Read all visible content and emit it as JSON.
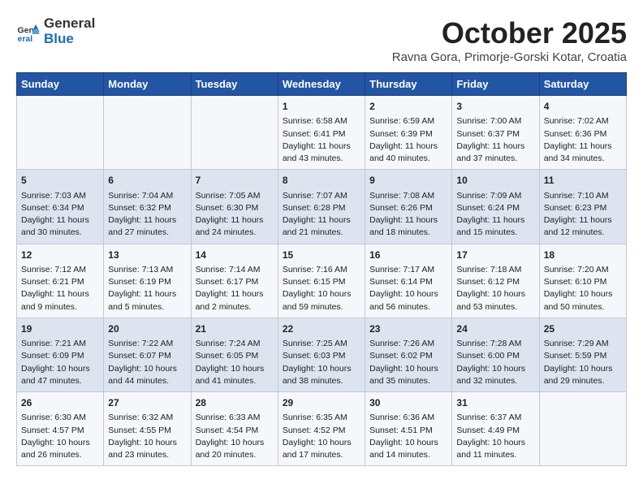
{
  "header": {
    "logo_line1": "General",
    "logo_line2": "Blue",
    "month": "October 2025",
    "location": "Ravna Gora, Primorje-Gorski Kotar, Croatia"
  },
  "days_of_week": [
    "Sunday",
    "Monday",
    "Tuesday",
    "Wednesday",
    "Thursday",
    "Friday",
    "Saturday"
  ],
  "weeks": [
    [
      {
        "day": "",
        "info": ""
      },
      {
        "day": "",
        "info": ""
      },
      {
        "day": "",
        "info": ""
      },
      {
        "day": "1",
        "info": "Sunrise: 6:58 AM\nSunset: 6:41 PM\nDaylight: 11 hours\nand 43 minutes."
      },
      {
        "day": "2",
        "info": "Sunrise: 6:59 AM\nSunset: 6:39 PM\nDaylight: 11 hours\nand 40 minutes."
      },
      {
        "day": "3",
        "info": "Sunrise: 7:00 AM\nSunset: 6:37 PM\nDaylight: 11 hours\nand 37 minutes."
      },
      {
        "day": "4",
        "info": "Sunrise: 7:02 AM\nSunset: 6:36 PM\nDaylight: 11 hours\nand 34 minutes."
      }
    ],
    [
      {
        "day": "5",
        "info": "Sunrise: 7:03 AM\nSunset: 6:34 PM\nDaylight: 11 hours\nand 30 minutes."
      },
      {
        "day": "6",
        "info": "Sunrise: 7:04 AM\nSunset: 6:32 PM\nDaylight: 11 hours\nand 27 minutes."
      },
      {
        "day": "7",
        "info": "Sunrise: 7:05 AM\nSunset: 6:30 PM\nDaylight: 11 hours\nand 24 minutes."
      },
      {
        "day": "8",
        "info": "Sunrise: 7:07 AM\nSunset: 6:28 PM\nDaylight: 11 hours\nand 21 minutes."
      },
      {
        "day": "9",
        "info": "Sunrise: 7:08 AM\nSunset: 6:26 PM\nDaylight: 11 hours\nand 18 minutes."
      },
      {
        "day": "10",
        "info": "Sunrise: 7:09 AM\nSunset: 6:24 PM\nDaylight: 11 hours\nand 15 minutes."
      },
      {
        "day": "11",
        "info": "Sunrise: 7:10 AM\nSunset: 6:23 PM\nDaylight: 11 hours\nand 12 minutes."
      }
    ],
    [
      {
        "day": "12",
        "info": "Sunrise: 7:12 AM\nSunset: 6:21 PM\nDaylight: 11 hours\nand 9 minutes."
      },
      {
        "day": "13",
        "info": "Sunrise: 7:13 AM\nSunset: 6:19 PM\nDaylight: 11 hours\nand 5 minutes."
      },
      {
        "day": "14",
        "info": "Sunrise: 7:14 AM\nSunset: 6:17 PM\nDaylight: 11 hours\nand 2 minutes."
      },
      {
        "day": "15",
        "info": "Sunrise: 7:16 AM\nSunset: 6:15 PM\nDaylight: 10 hours\nand 59 minutes."
      },
      {
        "day": "16",
        "info": "Sunrise: 7:17 AM\nSunset: 6:14 PM\nDaylight: 10 hours\nand 56 minutes."
      },
      {
        "day": "17",
        "info": "Sunrise: 7:18 AM\nSunset: 6:12 PM\nDaylight: 10 hours\nand 53 minutes."
      },
      {
        "day": "18",
        "info": "Sunrise: 7:20 AM\nSunset: 6:10 PM\nDaylight: 10 hours\nand 50 minutes."
      }
    ],
    [
      {
        "day": "19",
        "info": "Sunrise: 7:21 AM\nSunset: 6:09 PM\nDaylight: 10 hours\nand 47 minutes."
      },
      {
        "day": "20",
        "info": "Sunrise: 7:22 AM\nSunset: 6:07 PM\nDaylight: 10 hours\nand 44 minutes."
      },
      {
        "day": "21",
        "info": "Sunrise: 7:24 AM\nSunset: 6:05 PM\nDaylight: 10 hours\nand 41 minutes."
      },
      {
        "day": "22",
        "info": "Sunrise: 7:25 AM\nSunset: 6:03 PM\nDaylight: 10 hours\nand 38 minutes."
      },
      {
        "day": "23",
        "info": "Sunrise: 7:26 AM\nSunset: 6:02 PM\nDaylight: 10 hours\nand 35 minutes."
      },
      {
        "day": "24",
        "info": "Sunrise: 7:28 AM\nSunset: 6:00 PM\nDaylight: 10 hours\nand 32 minutes."
      },
      {
        "day": "25",
        "info": "Sunrise: 7:29 AM\nSunset: 5:59 PM\nDaylight: 10 hours\nand 29 minutes."
      }
    ],
    [
      {
        "day": "26",
        "info": "Sunrise: 6:30 AM\nSunset: 4:57 PM\nDaylight: 10 hours\nand 26 minutes."
      },
      {
        "day": "27",
        "info": "Sunrise: 6:32 AM\nSunset: 4:55 PM\nDaylight: 10 hours\nand 23 minutes."
      },
      {
        "day": "28",
        "info": "Sunrise: 6:33 AM\nSunset: 4:54 PM\nDaylight: 10 hours\nand 20 minutes."
      },
      {
        "day": "29",
        "info": "Sunrise: 6:35 AM\nSunset: 4:52 PM\nDaylight: 10 hours\nand 17 minutes."
      },
      {
        "day": "30",
        "info": "Sunrise: 6:36 AM\nSunset: 4:51 PM\nDaylight: 10 hours\nand 14 minutes."
      },
      {
        "day": "31",
        "info": "Sunrise: 6:37 AM\nSunset: 4:49 PM\nDaylight: 10 hours\nand 11 minutes."
      },
      {
        "day": "",
        "info": ""
      }
    ]
  ]
}
